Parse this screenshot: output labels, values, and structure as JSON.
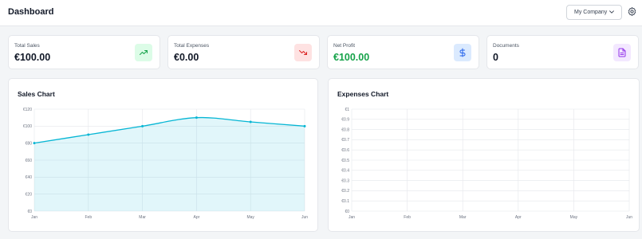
{
  "header": {
    "title": "Dashboard",
    "company_select": "My Company"
  },
  "stats": [
    {
      "label": "Total Sales",
      "value": "€100.00",
      "icon": "trending-up-icon",
      "accent": "#16a34a",
      "bg": "#dcfce7"
    },
    {
      "label": "Total Expenses",
      "value": "€0.00",
      "icon": "trending-down-icon",
      "accent": "#dc2626",
      "bg": "#fee2e2"
    },
    {
      "label": "Net Profit",
      "value": "€100.00",
      "icon": "dollar-icon",
      "accent": "#2563eb",
      "bg": "#dbeafe"
    },
    {
      "label": "Documents",
      "value": "0",
      "icon": "document-icon",
      "accent": "#9333ea",
      "bg": "#f3e8ff"
    }
  ],
  "chart_data": [
    {
      "type": "area",
      "title": "Sales Chart",
      "categories": [
        "Jan",
        "Feb",
        "Mar",
        "Apr",
        "May",
        "Jun"
      ],
      "series": [
        {
          "values": [
            80,
            90,
            100,
            110,
            105,
            100
          ],
          "color": "#06b6d4"
        }
      ],
      "ylim": [
        0,
        120
      ],
      "yticks": [
        "€0",
        "€20",
        "€40",
        "€60",
        "€80",
        "€100",
        "€120"
      ],
      "grid": true
    },
    {
      "type": "line",
      "title": "Expenses Chart",
      "categories": [
        "Jan",
        "Feb",
        "Mar",
        "Apr",
        "May",
        "Jun"
      ],
      "series": [],
      "ylim": [
        0,
        1
      ],
      "yticks": [
        "€0",
        "€0.1",
        "€0.2",
        "€0.3",
        "€0.4",
        "€0.5",
        "€0.6",
        "€0.7",
        "€0.8",
        "€0.9",
        "€1"
      ],
      "grid": true
    }
  ]
}
